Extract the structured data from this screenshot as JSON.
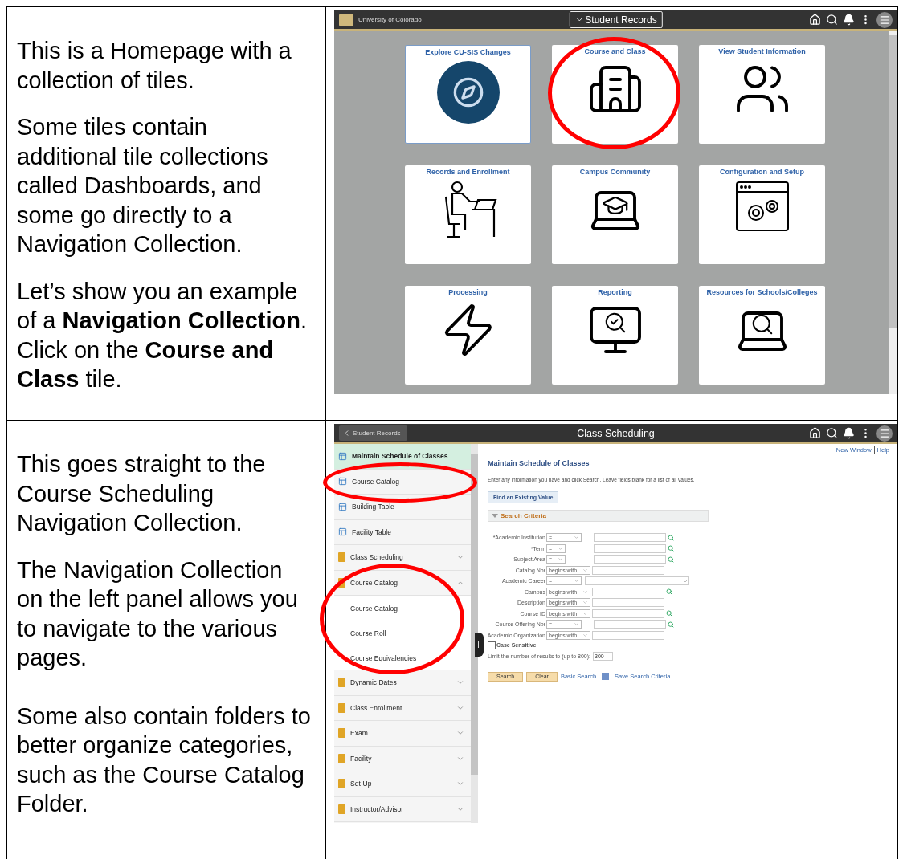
{
  "rows": [
    {
      "paragraphs": [
        "This is a Homepage with a collection of tiles.",
        "Some tiles contain additional tile collections called Dashboards, and some go directly to a Navigation Collection.",
        "Let’s show you an example of a **Navigation Collection**. Click on the **Course and Class** tile."
      ],
      "screen": {
        "kind": "homepage",
        "header": {
          "brand": "University of Colorado",
          "title": "Student Records"
        },
        "tiles": [
          {
            "title": "Explore CU-SIS Changes",
            "kind": "compass",
            "highlighted": false
          },
          {
            "title": "Course and Class",
            "kind": "buildings",
            "highlighted": true
          },
          {
            "title": "View Student Information",
            "kind": "people",
            "highlighted": false
          },
          {
            "title": "Records and Enrollment",
            "kind": "desk",
            "highlighted": false
          },
          {
            "title": "Campus Community",
            "kind": "campus",
            "highlighted": false
          },
          {
            "title": "Configuration and Setup",
            "kind": "gears",
            "highlighted": false
          },
          {
            "title": "Processing",
            "kind": "bolt",
            "highlighted": false
          },
          {
            "title": "Reporting",
            "kind": "monitor",
            "highlighted": false
          },
          {
            "title": "Resources for Schools/Colleges",
            "kind": "laptop",
            "highlighted": false
          }
        ]
      }
    },
    {
      "paragraphs": [
        "This goes straight to the Course Scheduling Navigation Collection.",
        "The Navigation Collection on the left panel allows you to navigate to the various pages.",
        "Some also contain folders to better organize categories, such as the Course Catalog Folder."
      ],
      "screen": {
        "kind": "navigation",
        "header": {
          "back": "Student Records",
          "title": "Class Scheduling"
        },
        "nav": [
          {
            "kind": "page",
            "label": "Maintain Schedule of Classes",
            "selected": true,
            "highlighted": false
          },
          {
            "kind": "page",
            "label": "Course Catalog",
            "selected": false,
            "highlighted": true
          },
          {
            "kind": "page",
            "label": "Building Table",
            "selected": false,
            "highlighted": false
          },
          {
            "kind": "page",
            "label": "Facility Table",
            "selected": false,
            "highlighted": false
          },
          {
            "kind": "folder",
            "label": "Class Scheduling",
            "expanded": false,
            "highlighted": false
          },
          {
            "kind": "folder",
            "label": "Course Catalog",
            "expanded": true,
            "highlighted": true,
            "children": [
              {
                "label": "Course Catalog"
              },
              {
                "label": "Course Roll"
              },
              {
                "label": "Course Equivalencies"
              }
            ]
          },
          {
            "kind": "folder",
            "label": "Dynamic Dates",
            "expanded": false,
            "highlighted": false
          },
          {
            "kind": "folder",
            "label": "Class Enrollment",
            "expanded": false,
            "highlighted": false
          },
          {
            "kind": "folder",
            "label": "Exam",
            "expanded": false,
            "highlighted": false
          },
          {
            "kind": "folder",
            "label": "Facility",
            "expanded": false,
            "highlighted": false
          },
          {
            "kind": "folder",
            "label": "Set-Up",
            "expanded": false,
            "highlighted": false
          },
          {
            "kind": "folder",
            "label": "Instructor/Advisor",
            "expanded": false,
            "highlighted": false
          }
        ],
        "links": [
          "New Window",
          "Help"
        ],
        "page_title": "Maintain Schedule of Classes",
        "instructions": "Enter any information you have and click Search. Leave fields blank for a list of all values.",
        "tab": "Find an Existing Value",
        "section": "Search Criteria",
        "fields": [
          {
            "label": "*Academic Institution",
            "operator": "=",
            "kind": "text",
            "lookup": true
          },
          {
            "label": "*Term",
            "operator": "=",
            "kind": "text",
            "lookup": true
          },
          {
            "label": "Subject Area",
            "operator": "=",
            "kind": "text",
            "lookup": true
          },
          {
            "label": "Catalog Nbr",
            "operator": "begins with",
            "kind": "text",
            "lookup": false
          },
          {
            "label": "Academic Career",
            "operator": "=",
            "kind": "select",
            "lookup": false
          },
          {
            "label": "Campus",
            "operator": "begins with",
            "kind": "text",
            "lookup": true
          },
          {
            "label": "Description",
            "operator": "begins with",
            "kind": "text",
            "lookup": false
          },
          {
            "label": "Course ID",
            "operator": "begins with",
            "kind": "text",
            "lookup": true
          },
          {
            "label": "Course Offering Nbr",
            "operator": "=",
            "kind": "text",
            "lookup": true
          },
          {
            "label": "Academic Organization",
            "operator": "begins with",
            "kind": "text",
            "lookup": false
          }
        ],
        "case_sensitive": {
          "label": "Case Sensitive",
          "checked": false
        },
        "limit": {
          "label": "Limit the number of results to (up to 800):",
          "value": "300"
        },
        "buttons": [
          "Search",
          "Clear"
        ],
        "basic_search": "Basic Search",
        "save_search": "Save Search Criteria"
      }
    }
  ]
}
